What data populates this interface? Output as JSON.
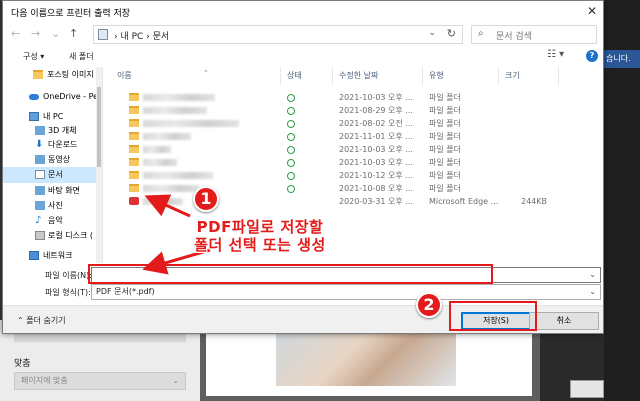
{
  "background": {
    "right_notice": "습니다.",
    "fit_label": "맞춤",
    "fit_select": "페이지에 맞춤"
  },
  "dialog": {
    "title": "다음 이름으로 프린터 출력 저장",
    "close": "✕",
    "nav": {
      "back": "←",
      "forward": "→",
      "recent": "⌄",
      "up": "↑"
    },
    "address": {
      "crumbs": "›  내 PC  ›  문서",
      "dropdown": "⌄",
      "refresh": "↻"
    },
    "search": {
      "placeholder": "문서 검색",
      "icon": "⌕"
    },
    "toolbar": {
      "organize": "구성 ▾",
      "new_folder": "새 폴더",
      "view": "☷ ▾",
      "help": "?"
    },
    "sidebar": {
      "items": [
        {
          "label": "포스팅 이미지",
          "icon": "folder"
        },
        {
          "label": "OneDrive - Per",
          "icon": "cloud"
        },
        {
          "label": "내 PC",
          "icon": "pc"
        },
        {
          "label": "3D 개체",
          "icon": "blue"
        },
        {
          "label": "다운로드",
          "icon": "download"
        },
        {
          "label": "동영상",
          "icon": "blue"
        },
        {
          "label": "문서",
          "icon": "doc",
          "selected": true
        },
        {
          "label": "바탕 화면",
          "icon": "blue"
        },
        {
          "label": "사진",
          "icon": "blue"
        },
        {
          "label": "음악",
          "icon": "music"
        },
        {
          "label": "로컬 디스크 (",
          "icon": "disk"
        },
        {
          "label": "네트워크",
          "icon": "net"
        }
      ]
    },
    "columns": {
      "name": "이름",
      "status": "상태",
      "modified": "수정한 날짜",
      "type": "유형",
      "size": "크기"
    },
    "files": [
      {
        "modified": "2021-10-03 오후 ...",
        "type": "파일 폴더",
        "size": ""
      },
      {
        "modified": "2021-08-29 오후 ...",
        "type": "파일 폴더",
        "size": ""
      },
      {
        "modified": "2021-08-02 오전 ...",
        "type": "파일 폴더",
        "size": ""
      },
      {
        "modified": "2021-11-01 오후 ...",
        "type": "파일 폴더",
        "size": ""
      },
      {
        "modified": "2021-10-03 오후 ...",
        "type": "파일 폴더",
        "size": ""
      },
      {
        "modified": "2021-10-03 오후 ...",
        "type": "파일 폴더",
        "size": ""
      },
      {
        "modified": "2021-10-12 오후 ...",
        "type": "파일 폴더",
        "size": ""
      },
      {
        "modified": "2021-10-08 오후 ...",
        "type": "파일 폴더",
        "size": ""
      },
      {
        "modified": "2020-03-31 오후 ...",
        "type": "Microsoft Edge ...",
        "size": "244KB"
      }
    ],
    "filename": {
      "label": "파일 이름(N):",
      "value": ""
    },
    "filetype": {
      "label": "파일 형식(T):",
      "value": "PDF 문서(*.pdf)"
    },
    "hide_folders": "⌃  폴더 숨기기",
    "save_button": "저장(S)",
    "cancel_button": "취소"
  },
  "annotations": {
    "badge1": "1",
    "badge2": "2",
    "text_line1": "PDF파일로 저장할",
    "text_line2": "폴더 선택 또는 생성",
    "color": "#e31b1b"
  }
}
